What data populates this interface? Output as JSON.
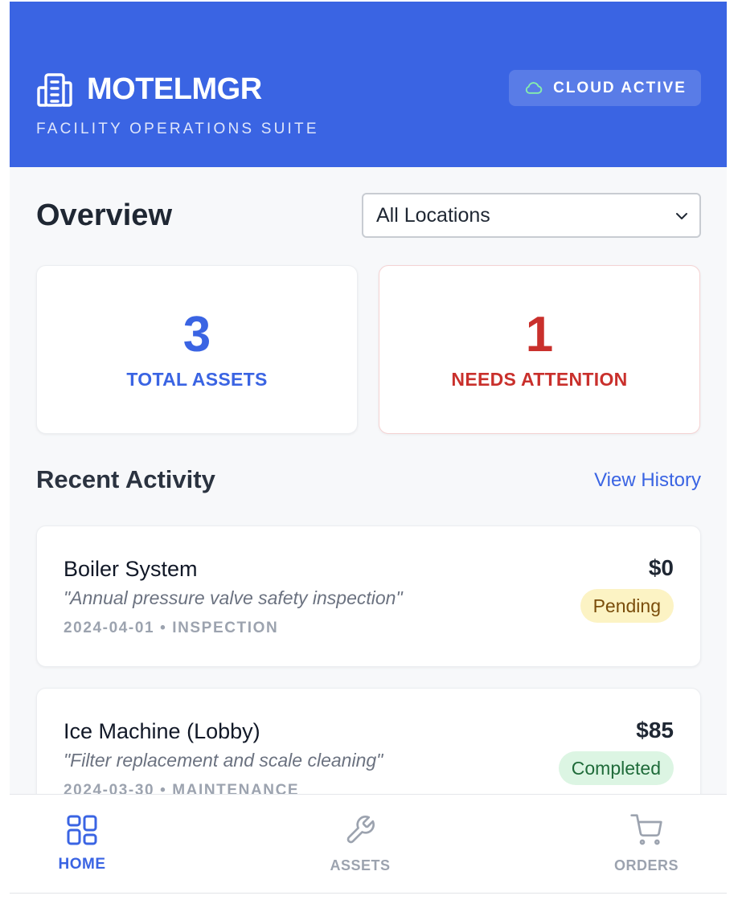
{
  "header": {
    "brand_name": "MOTELMGR",
    "brand_subtitle": "FACILITY OPERATIONS SUITE",
    "cloud_status": "CLOUD ACTIVE",
    "brand_icon": "building-icon",
    "cloud_icon": "cloud-icon"
  },
  "overview": {
    "title": "Overview",
    "location_select": {
      "selected": "All Locations"
    }
  },
  "stats": {
    "total_assets": {
      "value": "3",
      "label": "TOTAL ASSETS"
    },
    "needs_attention": {
      "value": "1",
      "label": "NEEDS ATTENTION"
    }
  },
  "activity": {
    "title": "Recent Activity",
    "view_history_label": "View History",
    "items": [
      {
        "name": "Boiler System",
        "description": "\"Annual pressure valve safety inspection\"",
        "meta": "2024-04-01 • INSPECTION",
        "cost": "$0",
        "status": "Pending"
      },
      {
        "name": "Ice Machine (Lobby)",
        "description": "\"Filter replacement and scale cleaning\"",
        "meta": "2024-03-30 • MAINTENANCE",
        "cost": "$85",
        "status": "Completed"
      }
    ]
  },
  "nav": {
    "items": [
      {
        "label": "HOME",
        "icon": "dashboard-icon",
        "active": true
      },
      {
        "label": "ASSETS",
        "icon": "wrench-icon",
        "active": false
      },
      {
        "label": "ORDERS",
        "icon": "cart-icon",
        "active": false
      }
    ]
  },
  "colors": {
    "primary": "#3a64e3",
    "danger": "#c9302c",
    "pending_bg": "#fcf3c4",
    "completed_bg": "#dcf5e3"
  }
}
